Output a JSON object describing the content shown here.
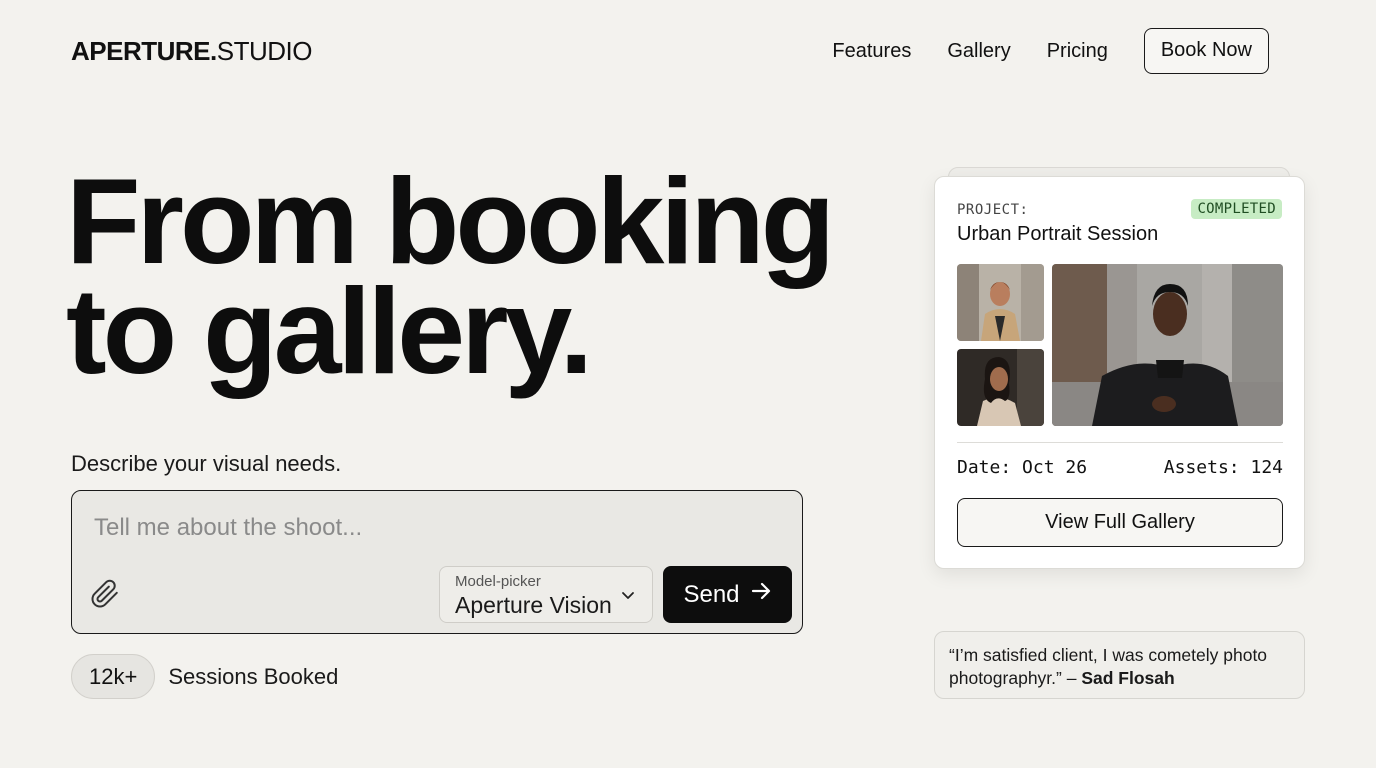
{
  "header": {
    "logo_bold": "APERTURE.",
    "logo_light": "STUDIO",
    "nav": [
      "Features",
      "Gallery",
      "Pricing"
    ],
    "cta": "Book Now"
  },
  "hero": {
    "line1": "From booking",
    "line2": "to gallery."
  },
  "prompt": {
    "label": "Describe your visual needs.",
    "placeholder": "Tell me about the shoot...",
    "attach_icon": "paperclip-icon",
    "model_picker_label": "Model-picker",
    "model_picker_value": "Aperture Vision",
    "send_label": "Send",
    "send_icon": "arrow-right-icon"
  },
  "stats": {
    "value": "12k+",
    "label": "Sessions Booked"
  },
  "project_card": {
    "label": "PROJECT:",
    "status": "COMPLETED",
    "status_color": "#c7ecc4",
    "title": "Urban Portrait Session",
    "date": "Date: Oct 26",
    "assets": "Assets: 124",
    "gallery_button": "View Full Gallery"
  },
  "testimonial": {
    "quote": "“I’m satisfied client, I was cometely photo photographyr.” –",
    "author": "Sad Flosah"
  }
}
